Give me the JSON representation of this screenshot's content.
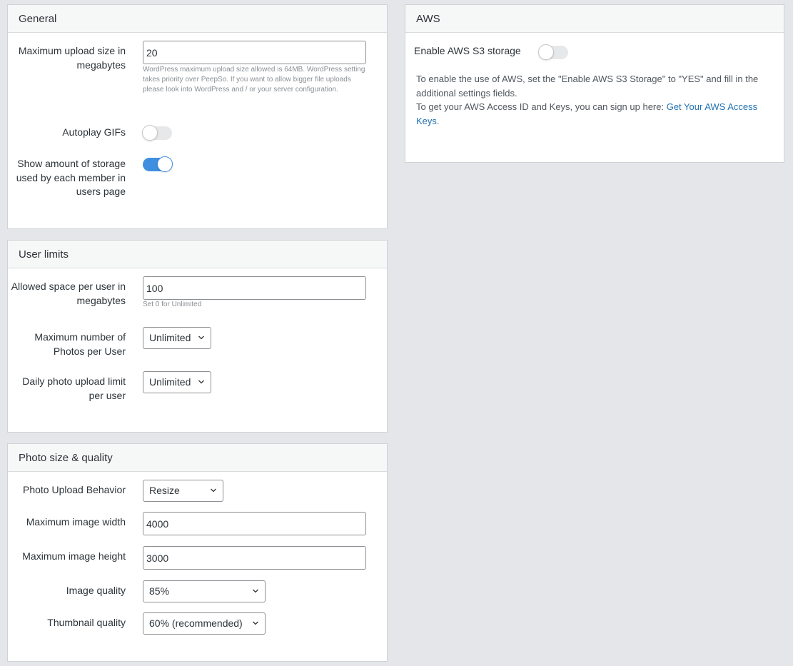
{
  "general": {
    "title": "General",
    "max_upload_label": "Maximum upload size in megabytes",
    "max_upload_value": "20",
    "max_upload_help": "WordPress maximum upload size allowed is 64MB. WordPress setting takes priority over PeepSo. If you want to allow bigger file uploads please look into WordPress and / or your server configuration.",
    "autoplay_label": "Autoplay GIFs",
    "autoplay_enabled": false,
    "storage_label": "Show amount of storage used by each member in users page",
    "storage_enabled": true
  },
  "user_limits": {
    "title": "User limits",
    "space_label": "Allowed space per user in megabytes",
    "space_value": "100",
    "space_help": "Set 0 for Unlimited",
    "max_photos_label": "Maximum number of Photos per User",
    "max_photos_value": "Unlimited",
    "daily_limit_label": "Daily photo upload limit per user",
    "daily_limit_value": "Unlimited"
  },
  "photo_size": {
    "title": "Photo size & quality",
    "behavior_label": "Photo Upload Behavior",
    "behavior_value": "Resize",
    "width_label": "Maximum image width",
    "width_value": "4000",
    "height_label": "Maximum image height",
    "height_value": "3000",
    "quality_label": "Image quality",
    "quality_value": "85%",
    "thumb_label": "Thumbnail quality",
    "thumb_value": "60% (recommended)"
  },
  "aws": {
    "title": "AWS",
    "enable_label": "Enable AWS S3 storage",
    "enable_enabled": false,
    "desc_line1": "To enable the use of AWS, set the \"Enable AWS S3 Storage\" to \"YES\" and fill in the additional settings fields.",
    "desc_line2": "To get your AWS Access ID and Keys, you can sign up here: ",
    "link_text": "Get Your AWS Access Keys."
  },
  "colors": {
    "accent": "#3f8fe0",
    "link": "#2271b1",
    "background": "#e5e6ea"
  }
}
